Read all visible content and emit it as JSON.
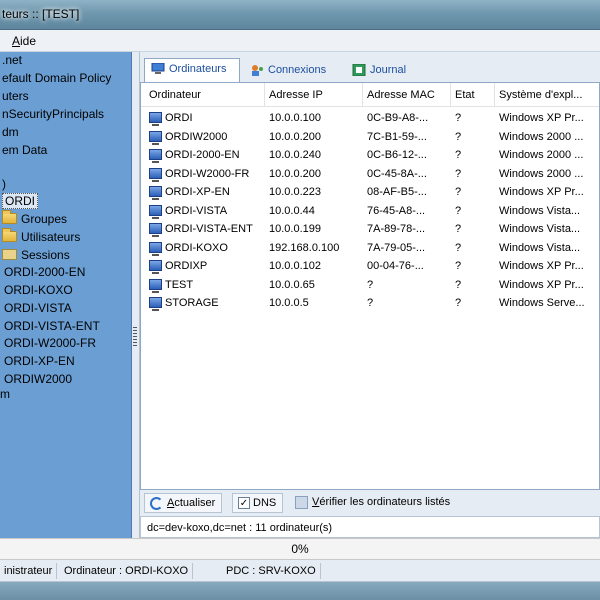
{
  "window": {
    "title": "teurs :: [TEST]"
  },
  "menubar": {
    "item_prefix": "",
    "item_underlined": "A",
    "item_rest": "ide"
  },
  "tree": {
    "items": [
      {
        "label": ".net"
      },
      {
        "label": "efault Domain Policy"
      },
      {
        "label": "uters"
      },
      {
        "label": "nSecurityPrincipals"
      },
      {
        "label": "dm"
      },
      {
        "label": "em Data"
      },
      {
        "label": ")"
      },
      {
        "label": "ORDI"
      },
      {
        "label": "Groupes"
      },
      {
        "label": "Utilisateurs"
      },
      {
        "label": "Sessions"
      },
      {
        "label": "ORDI-2000-EN"
      },
      {
        "label": "ORDI-KOXO"
      },
      {
        "label": "ORDI-VISTA"
      },
      {
        "label": "ORDI-VISTA-ENT"
      },
      {
        "label": "ORDI-W2000-FR"
      },
      {
        "label": "ORDI-XP-EN"
      },
      {
        "label": "ORDIW2000"
      },
      {
        "label": "m"
      }
    ]
  },
  "tabs": [
    {
      "label": "Ordinateurs",
      "icon": "computer-icon",
      "active": true
    },
    {
      "label": "Connexions",
      "icon": "connections-icon",
      "active": false
    },
    {
      "label": "Journal",
      "icon": "journal-icon",
      "active": false
    }
  ],
  "grid": {
    "headers": [
      "Ordinateur",
      "Adresse IP",
      "Adresse MAC",
      "Etat",
      "Système d'expl..."
    ],
    "rows": [
      [
        "ORDI",
        "10.0.0.100",
        "0C-B9-A8-...",
        "?",
        "Windows XP Pr..."
      ],
      [
        "ORDIW2000",
        "10.0.0.200",
        "7C-B1-59-...",
        "?",
        "Windows 2000 ..."
      ],
      [
        "ORDI-2000-EN",
        "10.0.0.240",
        "0C-B6-12-...",
        "?",
        "Windows 2000 ..."
      ],
      [
        "ORDI-W2000-FR",
        "10.0.0.200",
        "0C-45-8A-...",
        "?",
        "Windows 2000 ..."
      ],
      [
        "ORDI-XP-EN",
        "10.0.0.223",
        "08-AF-B5-...",
        "?",
        "Windows XP Pr..."
      ],
      [
        "ORDI-VISTA",
        "10.0.0.44",
        "76-45-A8-...",
        "?",
        "Windows Vista..."
      ],
      [
        "ORDI-VISTA-ENT",
        "10.0.0.199",
        "7A-89-78-...",
        "?",
        "Windows Vista..."
      ],
      [
        "ORDI-KOXO",
        "192.168.0.100",
        "7A-79-05-...",
        "?",
        "Windows Vista..."
      ],
      [
        "ORDIXP",
        "10.0.0.102",
        "00-04-76-...",
        "?",
        "Windows XP Pr..."
      ],
      [
        "TEST",
        "10.0.0.65",
        "?",
        "?",
        "Windows XP Pr..."
      ],
      [
        "STORAGE",
        "10.0.0.5",
        "?",
        "?",
        "Windows Serve..."
      ]
    ]
  },
  "bottombar": {
    "refresh_underlined": "A",
    "refresh_rest": "ctualiser",
    "dns_label": "DNS",
    "dns_checked": true,
    "verify_underlined": "V",
    "verify_rest": "érifier les ordinateurs listés"
  },
  "status_line": "dc=dev-koxo,dc=net : 11 ordinateur(s)",
  "progress": {
    "value": 0,
    "label": "0%"
  },
  "statusbar": {
    "user": "inistrateur",
    "computer": "Ordinateur : ORDI-KOXO",
    "pdc": "PDC : SRV-KOXO"
  },
  "colors": {
    "accent": "#1b4f9e",
    "tree_bg": "#6b9fd3",
    "progress_fill": "#6aa8e8"
  }
}
